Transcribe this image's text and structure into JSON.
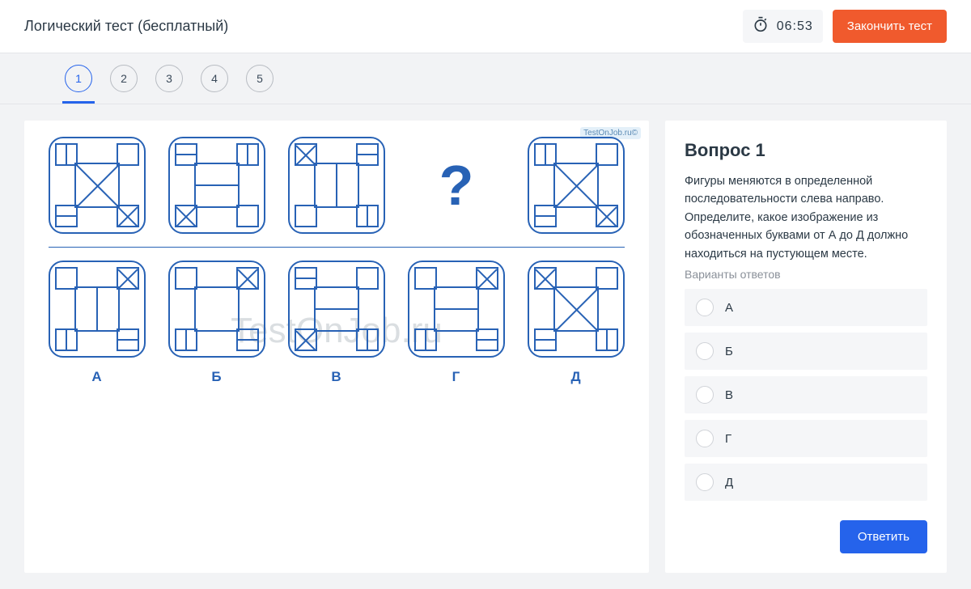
{
  "header": {
    "title": "Логический тест (бесплатный)",
    "timer": "06:53",
    "finish_label": "Закончить тест"
  },
  "nav": {
    "items": [
      "1",
      "2",
      "3",
      "4",
      "5"
    ],
    "active_index": 0
  },
  "question": {
    "title": "Вопрос 1",
    "text": "Фигуры меняются в определенной последовательности слева направо. Определите, какое изображение из обозначенных буквами от А до Д должно находиться на пустующем месте.",
    "options_label": "Варианты ответов",
    "options": [
      "А",
      "Б",
      "В",
      "Г",
      "Д"
    ],
    "submit_label": "Ответить"
  },
  "puzzle": {
    "answer_labels": [
      "А",
      "Б",
      "В",
      "Г",
      "Д"
    ],
    "question_mark": "?",
    "watermark_small": "TestOnJob.ru©",
    "watermark_big": "TestOnJob.ru"
  }
}
